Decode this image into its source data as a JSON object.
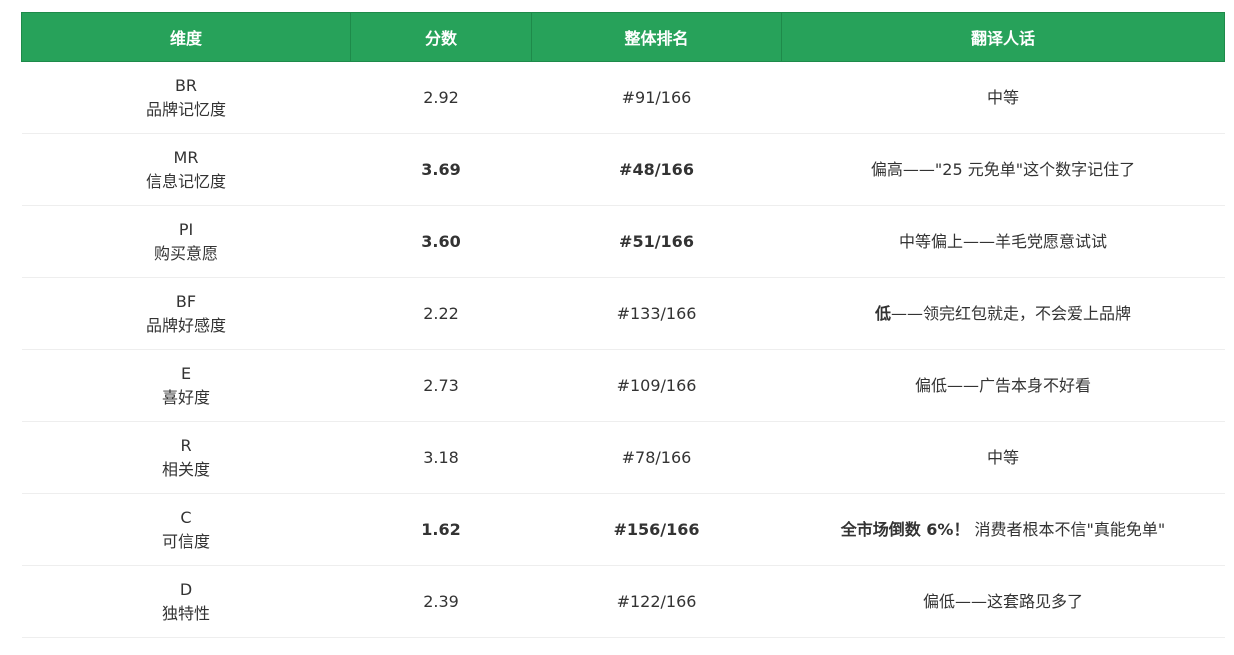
{
  "headers": [
    "维度",
    "分数",
    "整体排名",
    "翻译人话"
  ],
  "rows": [
    {
      "code": "BR",
      "name": "品牌记忆度",
      "score": "2.92",
      "rank": "#91/166",
      "note_strong": "",
      "note": "中等",
      "bold": false
    },
    {
      "code": "MR",
      "name": "信息记忆度",
      "score": "3.69",
      "rank": "#48/166",
      "note_strong": "",
      "note": "偏高——\"25 元免单\"这个数字记住了",
      "bold": true
    },
    {
      "code": "PI",
      "name": "购买意愿",
      "score": "3.60",
      "rank": "#51/166",
      "note_strong": "",
      "note": "中等偏上——羊毛党愿意试试",
      "bold": true
    },
    {
      "code": "BF",
      "name": "品牌好感度",
      "score": "2.22",
      "rank": "#133/166",
      "note_strong": "低",
      "note": "——领完红包就走，不会爱上品牌",
      "bold": false
    },
    {
      "code": "E",
      "name": "喜好度",
      "score": "2.73",
      "rank": "#109/166",
      "note_strong": "",
      "note": "偏低——广告本身不好看",
      "bold": false
    },
    {
      "code": "R",
      "name": "相关度",
      "score": "3.18",
      "rank": "#78/166",
      "note_strong": "",
      "note": "中等",
      "bold": false
    },
    {
      "code": "C",
      "name": "可信度",
      "score": "1.62",
      "rank": "#156/166",
      "note_strong": "全市场倒数 6%！",
      "note": " 消费者根本不信\"真能免单\"",
      "bold": true
    },
    {
      "code": "D",
      "name": "独特性",
      "score": "2.39",
      "rank": "#122/166",
      "note_strong": "",
      "note": "偏低——这套路见多了",
      "bold": false
    }
  ]
}
